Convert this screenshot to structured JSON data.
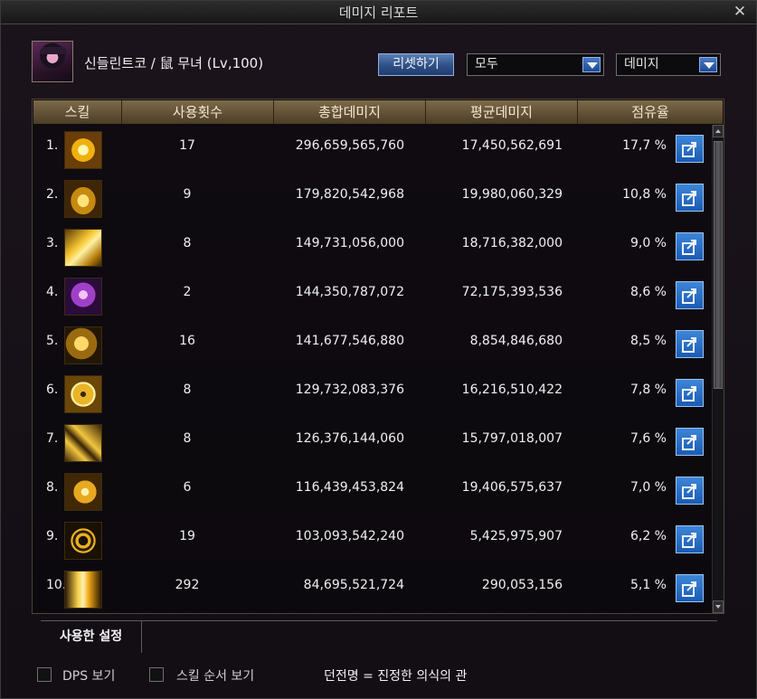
{
  "window": {
    "title": "데미지 리포트",
    "close_symbol": "✕"
  },
  "character": {
    "name": "신들린트코 / 鼠 무녀 (Lv,100)"
  },
  "controls": {
    "reset_label": "리셋하기",
    "filter_value": "모두",
    "metric_value": "데미지"
  },
  "table": {
    "headers": [
      "스킬",
      "사용횟수",
      "총합데미지",
      "평균데미지",
      "점유율"
    ],
    "rows": [
      {
        "rank": "1.",
        "count": "17",
        "total": "296,659,565,760",
        "avg": "17,450,562,691",
        "share": "17,7 %"
      },
      {
        "rank": "2.",
        "count": "9",
        "total": "179,820,542,968",
        "avg": "19,980,060,329",
        "share": "10,8 %"
      },
      {
        "rank": "3.",
        "count": "8",
        "total": "149,731,056,000",
        "avg": "18,716,382,000",
        "share": "9,0 %"
      },
      {
        "rank": "4.",
        "count": "2",
        "total": "144,350,787,072",
        "avg": "72,175,393,536",
        "share": "8,6 %"
      },
      {
        "rank": "5.",
        "count": "16",
        "total": "141,677,546,880",
        "avg": "8,854,846,680",
        "share": "8,5 %"
      },
      {
        "rank": "6.",
        "count": "8",
        "total": "129,732,083,376",
        "avg": "16,216,510,422",
        "share": "7,8 %"
      },
      {
        "rank": "7.",
        "count": "8",
        "total": "126,376,144,060",
        "avg": "15,797,018,007",
        "share": "7,6 %"
      },
      {
        "rank": "8.",
        "count": "6",
        "total": "116,439,453,824",
        "avg": "19,406,575,637",
        "share": "7,0 %"
      },
      {
        "rank": "9.",
        "count": "19",
        "total": "103,093,542,240",
        "avg": "5,425,975,907",
        "share": "6,2 %"
      },
      {
        "rank": "10.",
        "count": "292",
        "total": "84,695,521,724",
        "avg": "290,053,156",
        "share": "5,1 %"
      }
    ]
  },
  "settings": {
    "tab_label": "사용한 설정",
    "dps_label": "DPS 보기",
    "order_label": "스킬 순서 보기",
    "dungeon_label": "던전명 = 진정한 의식의 관"
  },
  "icons": [
    "skill-sun-icon",
    "skill-wave-icon",
    "skill-drum-icon",
    "skill-spirit-icon",
    "skill-dragon-icon",
    "skill-orb-icon",
    "skill-cross-icon",
    "skill-beast-icon",
    "skill-yinyang-icon",
    "skill-dash-icon",
    "share-icon"
  ],
  "colors": {
    "accent_blue": "#2e6ac4",
    "header_bronze": "#6d5a3d",
    "icon_gold": "#e8b020"
  }
}
